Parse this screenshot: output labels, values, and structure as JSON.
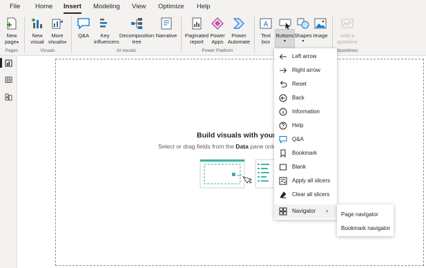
{
  "menu": {
    "tabs": [
      "File",
      "Home",
      "Insert",
      "Modeling",
      "View",
      "Optimize",
      "Help"
    ],
    "active": "Insert"
  },
  "ribbon": {
    "new_page": {
      "line1": "New",
      "line2": "page"
    },
    "new_visual": {
      "line1": "New",
      "line2": "visual"
    },
    "more_visuals": {
      "line1": "More",
      "line2": "visuals"
    },
    "qa": "Q&A",
    "key_influencers": {
      "line1": "Key",
      "line2": "influencers"
    },
    "decomposition_tree": {
      "line1": "Decomposition",
      "line2": "tree"
    },
    "narrative": "Narrative",
    "paginated_report": {
      "line1": "Paginated",
      "line2": "report"
    },
    "power_apps": {
      "line1": "Power",
      "line2": "Apps"
    },
    "power_automate": {
      "line1": "Power",
      "line2": "Automate"
    },
    "text_box": {
      "line1": "Text",
      "line2": "box"
    },
    "buttons": "Buttons",
    "shapes": "Shapes",
    "image": "Image",
    "add_sparkline": {
      "line1": "Add a",
      "line2": "sparkline"
    },
    "groups": {
      "pages": "Pages",
      "visuals": "Visuals",
      "ai_visuals": "AI visuals",
      "power_platform": "Power Platform",
      "sparklines": "Sparklines"
    }
  },
  "canvas": {
    "title": "Build visuals with your da",
    "subtitle_pre": "Select or drag fields from the ",
    "subtitle_bold": "Data",
    "subtitle_post": " pane onto"
  },
  "buttons_menu": {
    "items": [
      {
        "label": "Left arrow",
        "icon": "left-arrow-icon"
      },
      {
        "label": "Right arrow",
        "icon": "right-arrow-icon"
      },
      {
        "label": "Reset",
        "icon": "reset-icon"
      },
      {
        "label": "Back",
        "icon": "back-icon"
      },
      {
        "label": "Information",
        "icon": "information-icon"
      },
      {
        "label": "Help",
        "icon": "help-icon"
      },
      {
        "label": "Q&A",
        "icon": "qa-icon"
      },
      {
        "label": "Bookmark",
        "icon": "bookmark-icon"
      },
      {
        "label": "Blank",
        "icon": "blank-icon"
      },
      {
        "label": "Apply all slicers",
        "icon": "apply-slicers-icon"
      },
      {
        "label": "Clear all slicers",
        "icon": "eraser-icon"
      },
      {
        "label": "Navigator",
        "icon": "navigator-icon"
      }
    ]
  },
  "navigator_submenu": {
    "items": [
      "Page navigator",
      "Bookmark navigator"
    ]
  }
}
